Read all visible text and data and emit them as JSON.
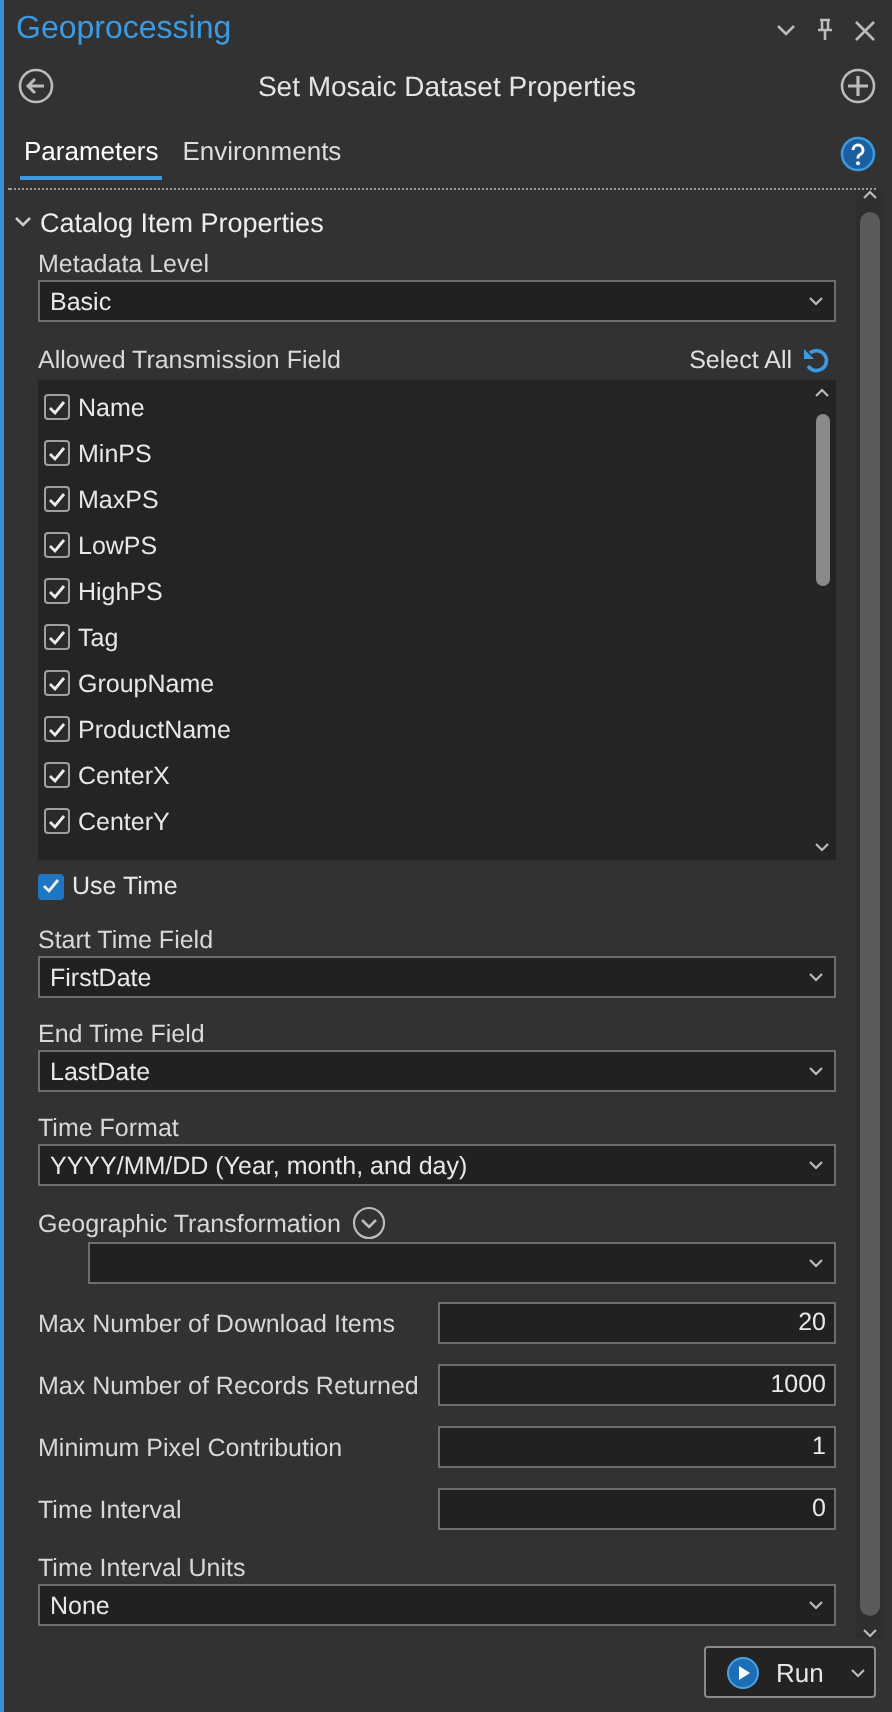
{
  "panel": {
    "title": "Geoprocessing"
  },
  "tool": {
    "title": "Set Mosaic Dataset Properties"
  },
  "tabs": [
    {
      "label": "Parameters",
      "selected": true
    },
    {
      "label": "Environments",
      "selected": false
    }
  ],
  "group": {
    "title": "Catalog Item Properties",
    "expanded": true
  },
  "parameters": [
    {
      "kind": "dropdown",
      "label": "Metadata Level",
      "value": "Basic"
    },
    {
      "kind": "checklist",
      "label": "Allowed Transmission Field",
      "action": "Select All",
      "items": [
        {
          "label": "Name",
          "checked": true
        },
        {
          "label": "MinPS",
          "checked": true
        },
        {
          "label": "MaxPS",
          "checked": true
        },
        {
          "label": "LowPS",
          "checked": true
        },
        {
          "label": "HighPS",
          "checked": true
        },
        {
          "label": "Tag",
          "checked": true
        },
        {
          "label": "GroupName",
          "checked": true
        },
        {
          "label": "ProductName",
          "checked": true
        },
        {
          "label": "CenterX",
          "checked": true
        },
        {
          "label": "CenterY",
          "checked": true
        }
      ]
    },
    {
      "kind": "checkbox",
      "label": "Use Time",
      "checked": true
    },
    {
      "kind": "dropdown",
      "label": "Start Time Field",
      "value": "FirstDate"
    },
    {
      "kind": "dropdown",
      "label": "End Time Field",
      "value": "LastDate"
    },
    {
      "kind": "dropdown",
      "label": "Time Format",
      "value": "YYYY/MM/DD (Year, month, and day)"
    },
    {
      "kind": "transformation",
      "label": "Geographic Transformation"
    },
    {
      "kind": "number",
      "label": "Max Number of Download Items",
      "value": "20"
    },
    {
      "kind": "number",
      "label": "Max Number of Records Returned",
      "value": "1000"
    },
    {
      "kind": "number",
      "label": "Minimum Pixel Contribution",
      "value": "1"
    },
    {
      "kind": "number",
      "label": "Time Interval",
      "value": "0"
    },
    {
      "kind": "dropdown",
      "label": "Time Interval Units",
      "value": "None"
    }
  ],
  "run": {
    "label": "Run"
  }
}
